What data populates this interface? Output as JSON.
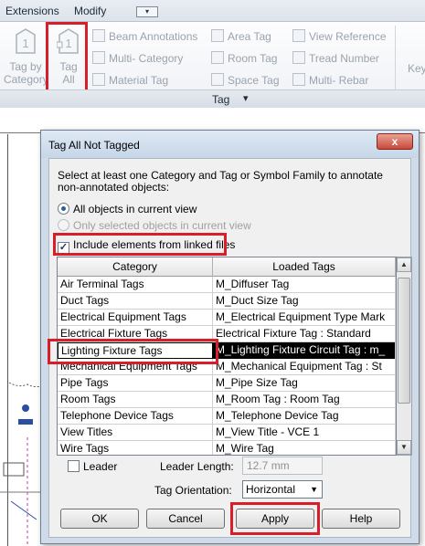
{
  "menubar": {
    "items": [
      "Extensions",
      "Modify"
    ],
    "dropdown_glyph": "▾"
  },
  "ribbon": {
    "big_tools": [
      {
        "line1": "Tag by",
        "line2": "Category",
        "glyph": "1"
      },
      {
        "line1": "Tag",
        "line2": "All",
        "glyph": "1"
      }
    ],
    "small_tools": [
      [
        "Beam Annotations",
        "Multi- Category",
        "Material Tag"
      ],
      [
        "Area Tag",
        "Room Tag",
        "Space Tag"
      ],
      [
        "View Reference",
        "Tread Number",
        "Multi- Rebar"
      ]
    ],
    "cut_label": "Key",
    "panel_label": "Tag",
    "panel_arrow": "▾"
  },
  "dialog": {
    "title": "Tag All Not Tagged",
    "close_glyph": "x",
    "instructions": "Select at least one Category and Tag or Symbol Family to annotate non-annotated objects:",
    "radio_all": "All objects in current view",
    "radio_selected": "Only selected objects in current view",
    "include_linked": "Include elements from linked files",
    "include_linked_check": "✓",
    "columns": [
      "Category",
      "Loaded Tags"
    ],
    "rows": [
      [
        "Air Terminal Tags",
        "M_Diffuser Tag"
      ],
      [
        "Duct Tags",
        "M_Duct Size Tag"
      ],
      [
        "Electrical Equipment Tags",
        "M_Electrical Equipment Type Mark"
      ],
      [
        "Electrical Fixture Tags",
        "Electrical Fixture Tag : Standard"
      ],
      [
        "Lighting Fixture Tags",
        "M_Lighting Fixture Circuit Tag : m_"
      ],
      [
        "Mechanical Equipment Tags",
        "M_Mechanical Equipment Tag : St"
      ],
      [
        "Pipe Tags",
        "M_Pipe Size Tag"
      ],
      [
        "Room Tags",
        "M_Room Tag : Room Tag"
      ],
      [
        "Telephone Device Tags",
        "M_Telephone Device Tag"
      ],
      [
        "View Titles",
        "M_View Title - VCE 1"
      ],
      [
        "Wire Tags",
        "M_Wire Tag"
      ]
    ],
    "selected_row": 4,
    "scroll_up": "▲",
    "scroll_down": "▼",
    "leader_label": "Leader",
    "leader_length_label": "Leader Length:",
    "leader_length_value": "12.7 mm",
    "orientation_label": "Tag Orientation:",
    "orientation_value": "Horizontal",
    "orientation_arrow": "▼",
    "buttons": {
      "ok": "OK",
      "cancel": "Cancel",
      "apply": "Apply",
      "help": "Help"
    }
  },
  "colors": {
    "highlight_box": "#d81e28",
    "dialog_frame": "#cfdbe8",
    "selection": "#000000"
  }
}
